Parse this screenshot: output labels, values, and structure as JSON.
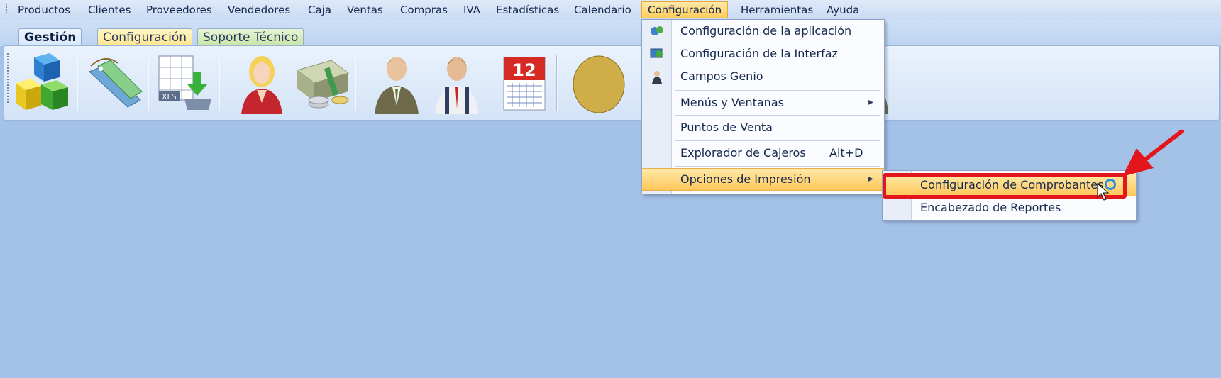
{
  "menubar": {
    "items": [
      "Productos",
      "Clientes",
      "Proveedores",
      "Vendedores",
      "Caja",
      "Ventas",
      "Compras",
      "IVA",
      "Estadísticas",
      "Calendario",
      "Configuración",
      "Herramientas",
      "Ayuda"
    ],
    "active": "Configuración"
  },
  "ribbon": {
    "tabs": [
      "Gestión",
      "Configuración",
      "Soporte Técnico"
    ],
    "icons": [
      "products-cubes-icon",
      "tags-icon",
      "excel-import-icon",
      "woman-vendor-icon",
      "money-coins-icon",
      "man-client-icon",
      "man-supplier-icon",
      "calendar-icon",
      "coin-icon",
      "man-glasses-icon"
    ],
    "calendar_day": "12"
  },
  "dropdown": {
    "items": [
      {
        "label": "Configuración de la aplicación",
        "icon": "app-config-icon"
      },
      {
        "label": "Configuración de la Interfaz",
        "icon": "interface-config-icon"
      },
      {
        "label": "Campos Genio",
        "icon": "genie-fields-icon"
      },
      {
        "label": "Menús y Ventanas",
        "submenu": true
      },
      {
        "label": "Puntos de Venta"
      },
      {
        "label": "Explorador de Cajeros",
        "shortcut": "Alt+D"
      },
      {
        "label": "Opciones de Impresión",
        "submenu": true,
        "highlighted": true
      }
    ]
  },
  "submenu": {
    "items": [
      {
        "label": "Configuración de Comprobantes",
        "highlighted": true
      },
      {
        "label": "Encabezado de Reportes"
      }
    ]
  },
  "colors": {
    "background": "#a4c2e8",
    "highlight": "#ffc75a",
    "annotation": "#e3161e"
  }
}
